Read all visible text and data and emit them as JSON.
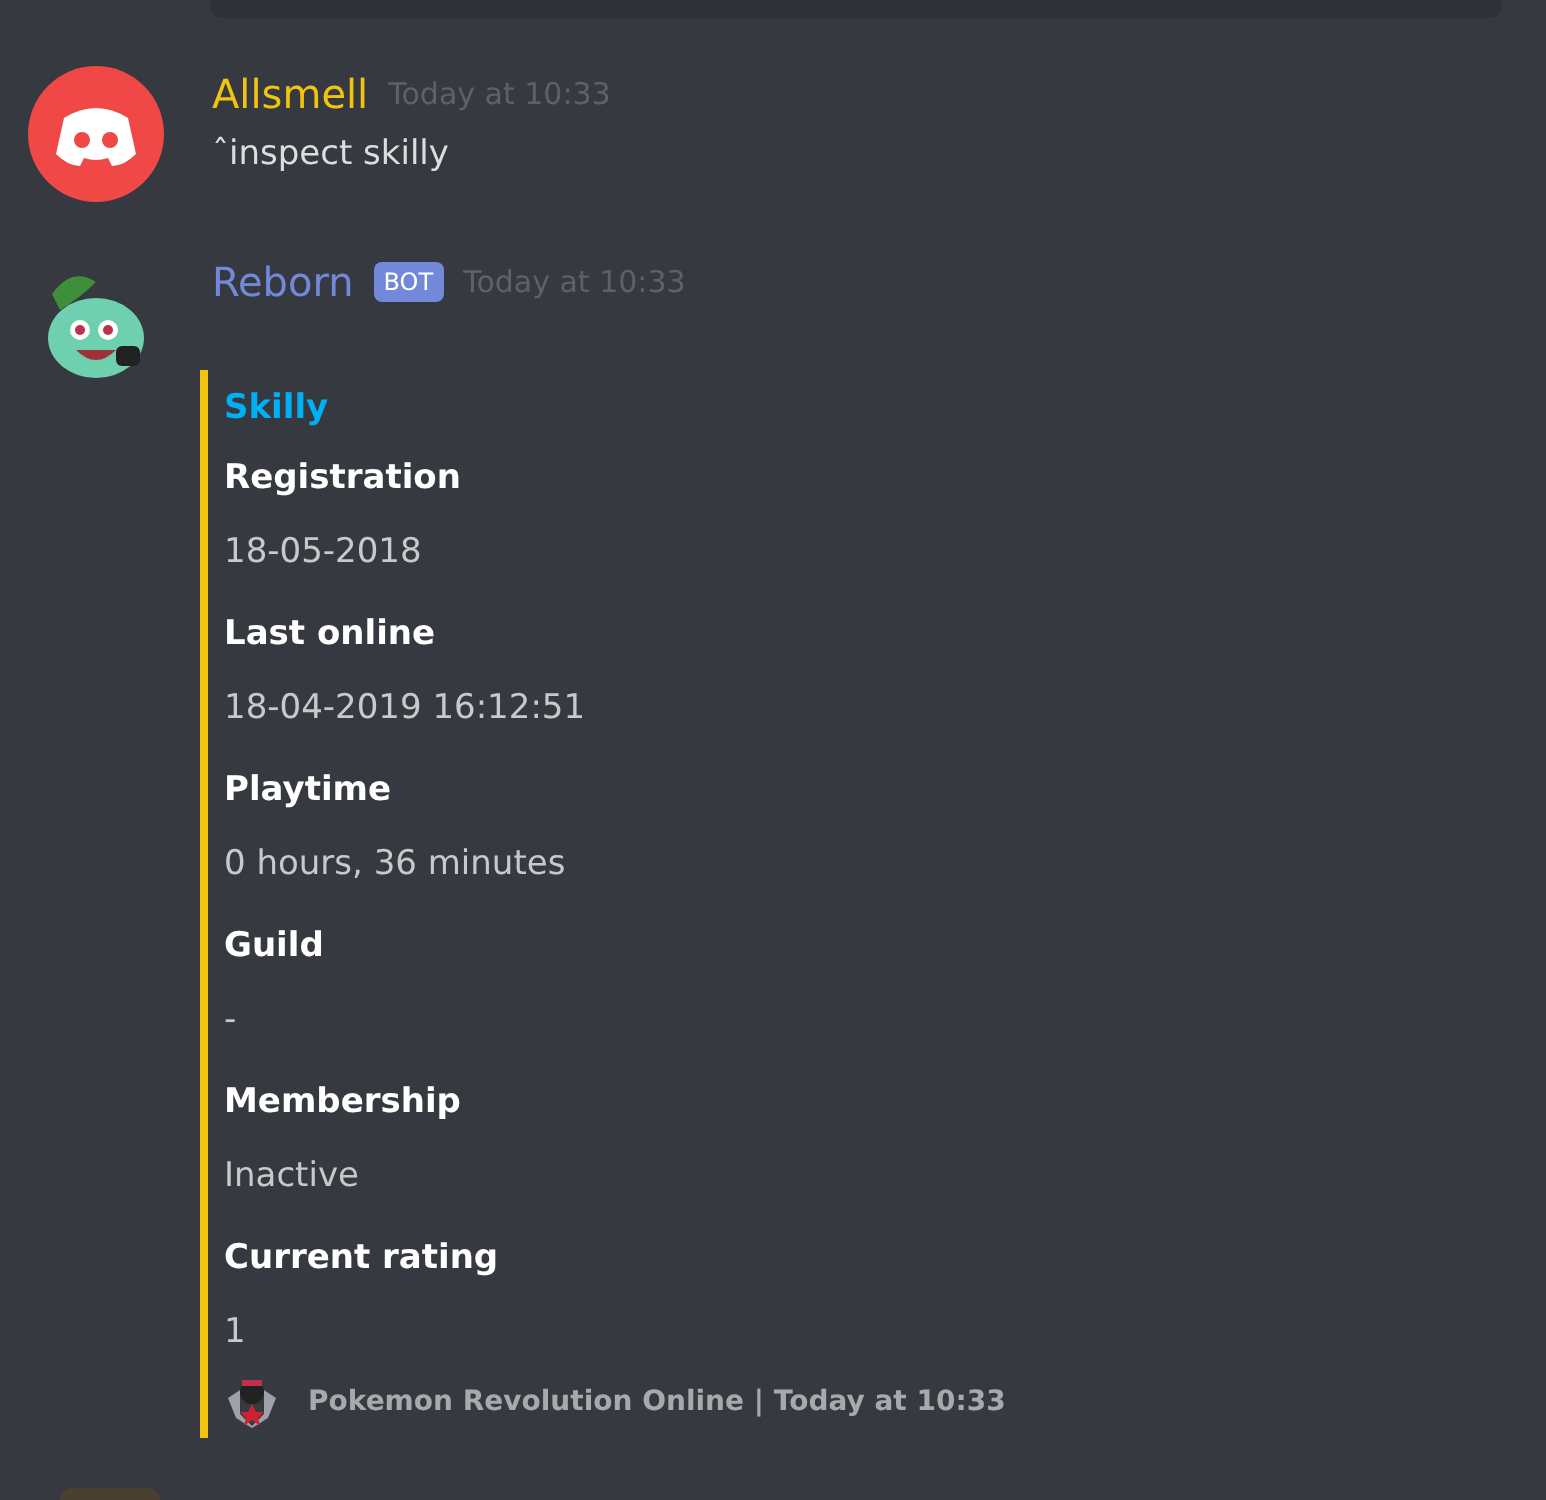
{
  "messages": [
    {
      "kind": "user",
      "author": "Allsmell",
      "color": "#f1c40f",
      "timestamp": "Today at 10:33",
      "text": "ˆinspect skilly"
    },
    {
      "kind": "bot",
      "author": "Reborn",
      "color": "#7289da",
      "badge": "BOT",
      "timestamp": "Today at 10:33",
      "embed": {
        "color": "#f1c40f",
        "title": "Skilly",
        "fields": [
          {
            "name": "Registration",
            "value": "18-05-2018"
          },
          {
            "name": "Last online",
            "value": "18-04-2019 16:12:51"
          },
          {
            "name": "Playtime",
            "value": "0 hours, 36 minutes"
          },
          {
            "name": "Guild",
            "value": "-"
          },
          {
            "name": "Membership",
            "value": "Inactive"
          },
          {
            "name": "Current rating",
            "value": "1"
          }
        ],
        "footer": "Pokemon Revolution Online | Today at 10:33"
      }
    }
  ]
}
